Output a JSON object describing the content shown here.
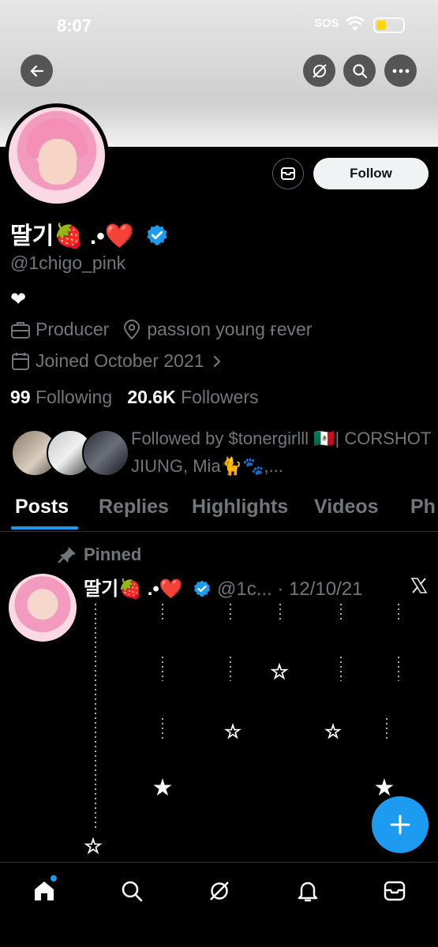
{
  "status_bar": {
    "time": "8:07",
    "sos": "SOS"
  },
  "top_buttons": [
    "back-arrow-icon",
    "grok-icon",
    "search-icon",
    "more-icon"
  ],
  "profile": {
    "display_name": "딸기🍓 .•❤️",
    "handle": "@1chigo_pink",
    "bio": "❤",
    "occupation": "Producer",
    "location": "passıon young ғever",
    "joined": "Joined October 2021",
    "following_count": "99",
    "following_label": "Following",
    "followers_count": "20.6K",
    "followers_label": "Followers",
    "followed_by": "Followed by $tonergirlll 🇲🇽| CORSHOT JIUNG, Mia🐈🐾,..."
  },
  "actions": {
    "follow_label": "Follow"
  },
  "tabs": [
    {
      "label": "Posts",
      "active": true
    },
    {
      "label": "Replies",
      "active": false
    },
    {
      "label": "Highlights",
      "active": false
    },
    {
      "label": "Videos",
      "active": false
    },
    {
      "label": "Ph",
      "active": false
    }
  ],
  "pinned_post": {
    "pinned_label": "Pinned",
    "author_name": "딸기🍓 .•❤️",
    "author_handle": "@1c...",
    "date": "· 12/10/21"
  },
  "colors": {
    "accent": "#1d9bf0",
    "background": "#000000",
    "muted": "#71767b"
  },
  "bottom_nav": [
    "home-icon",
    "search-icon",
    "grok-icon",
    "notifications-icon",
    "messages-icon"
  ]
}
